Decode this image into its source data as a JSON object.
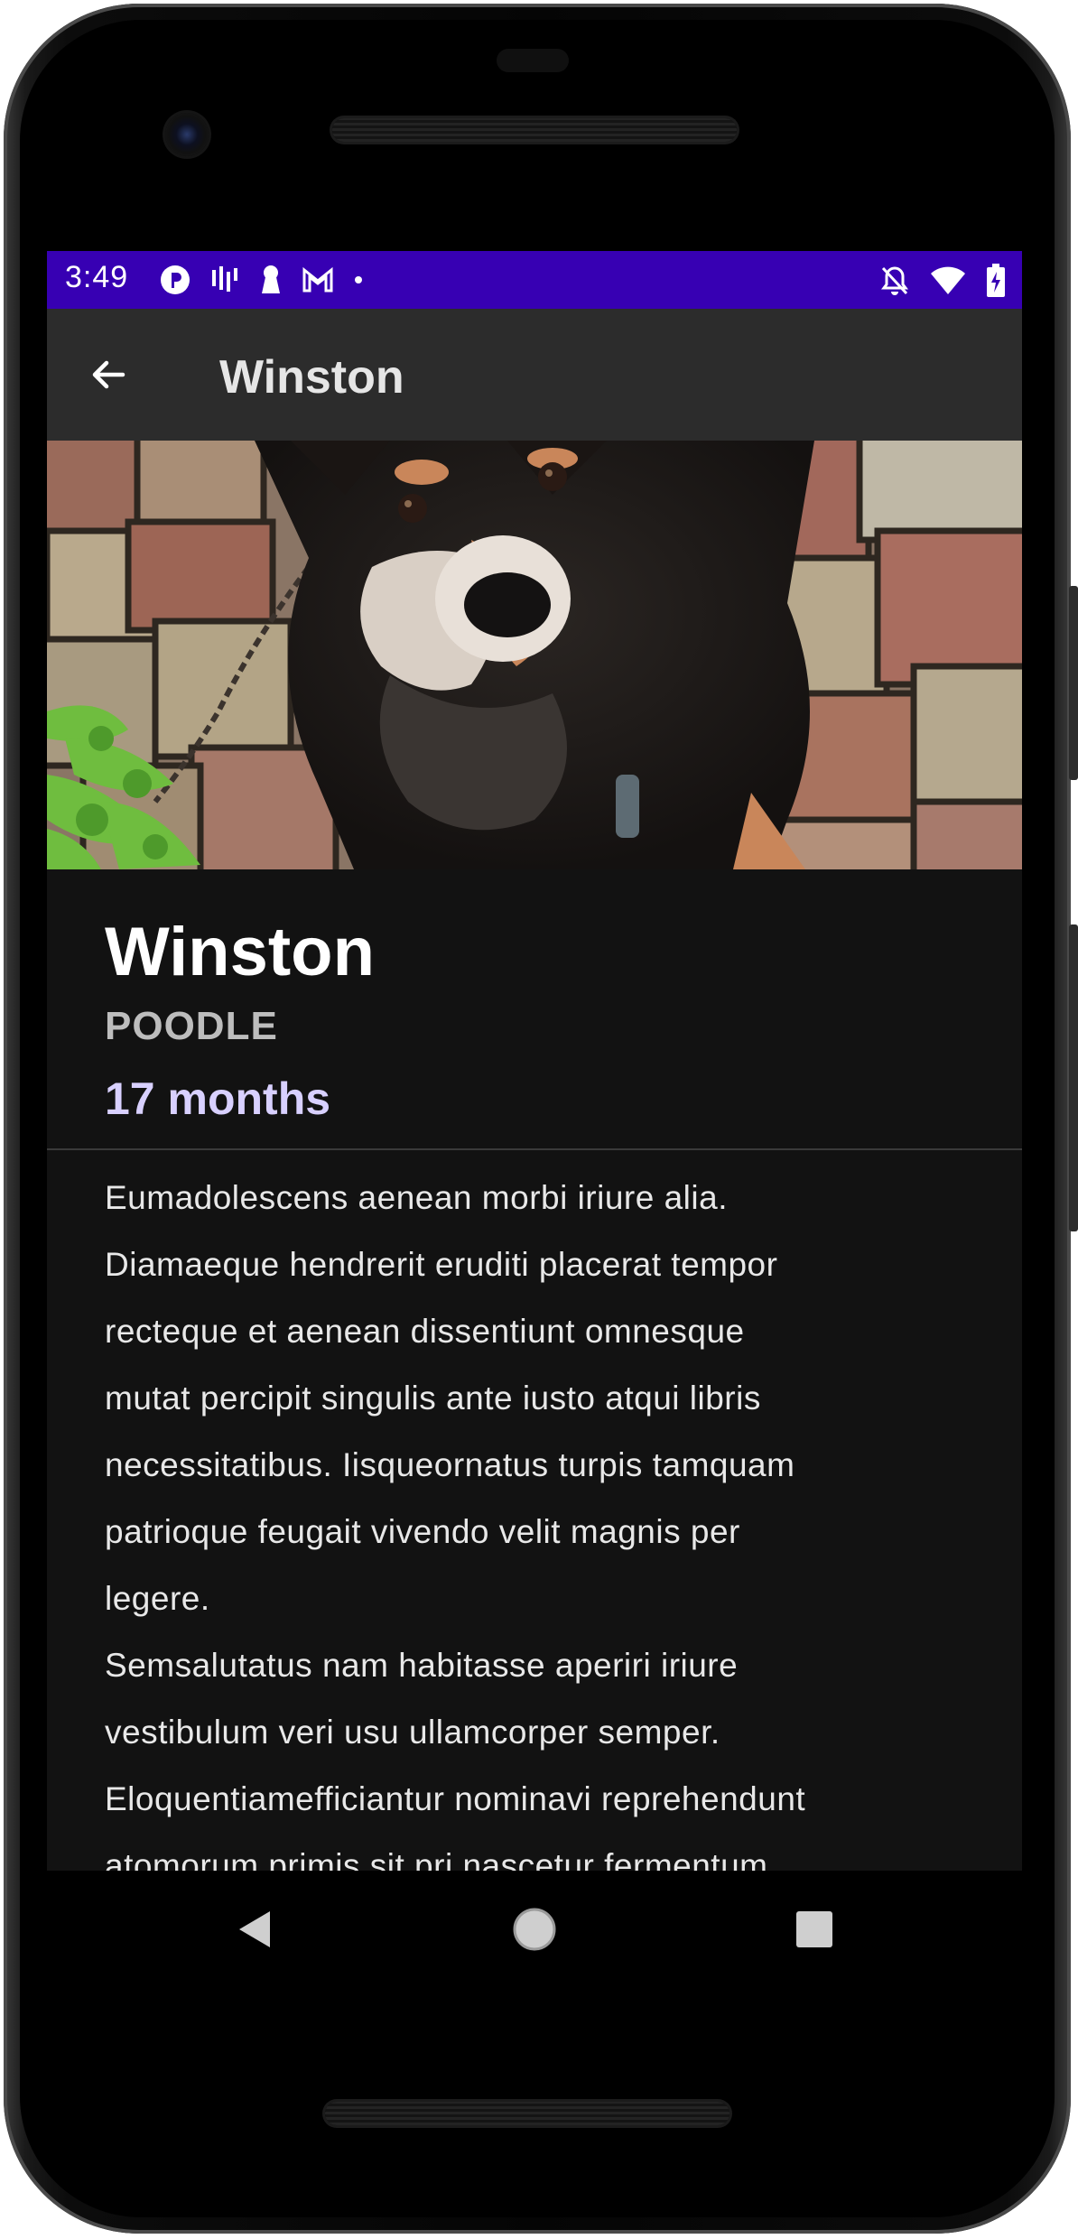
{
  "status_bar": {
    "time": "3:49",
    "background": "#3700b3",
    "left_icons": [
      "notification-app-icon",
      "signal-bars-icon",
      "keyhole-icon",
      "gmail-icon",
      "dot-icon"
    ],
    "right_icons": [
      "notifications-off-icon",
      "wifi-icon",
      "battery-charging-icon"
    ]
  },
  "app_bar": {
    "title": "Winston",
    "background": "#2c2c2c"
  },
  "pet": {
    "name": "Winston",
    "breed": "POODLE",
    "age": "17 months",
    "description": "Eumadolescens aenean morbi iriure alia.\nDiamaeque hendrerit eruditi placerat tempor\nrecteque et aenean dissentiunt omnesque\nmutat percipit singulis ante iusto atqui libris\nnecessitatibus.  Iisqueornatus turpis tamquam\npatrioque feugait vivendo velit magnis per\nlegere.\nSemsalutatus nam habitasse aperiri iriure\nvestibulum veri usu ullamcorper semper.\nEloquentiamefficiantur nominavi reprehendunt\natomorum primis sit pri nascetur fermentum."
  },
  "colors": {
    "screen_background": "#121212",
    "age_accent": "#d8d0ff",
    "breed_text": "#bdbdbd"
  },
  "nav_bar": {
    "buttons": [
      "back-triangle-icon",
      "home-circle-icon",
      "recents-square-icon"
    ]
  }
}
